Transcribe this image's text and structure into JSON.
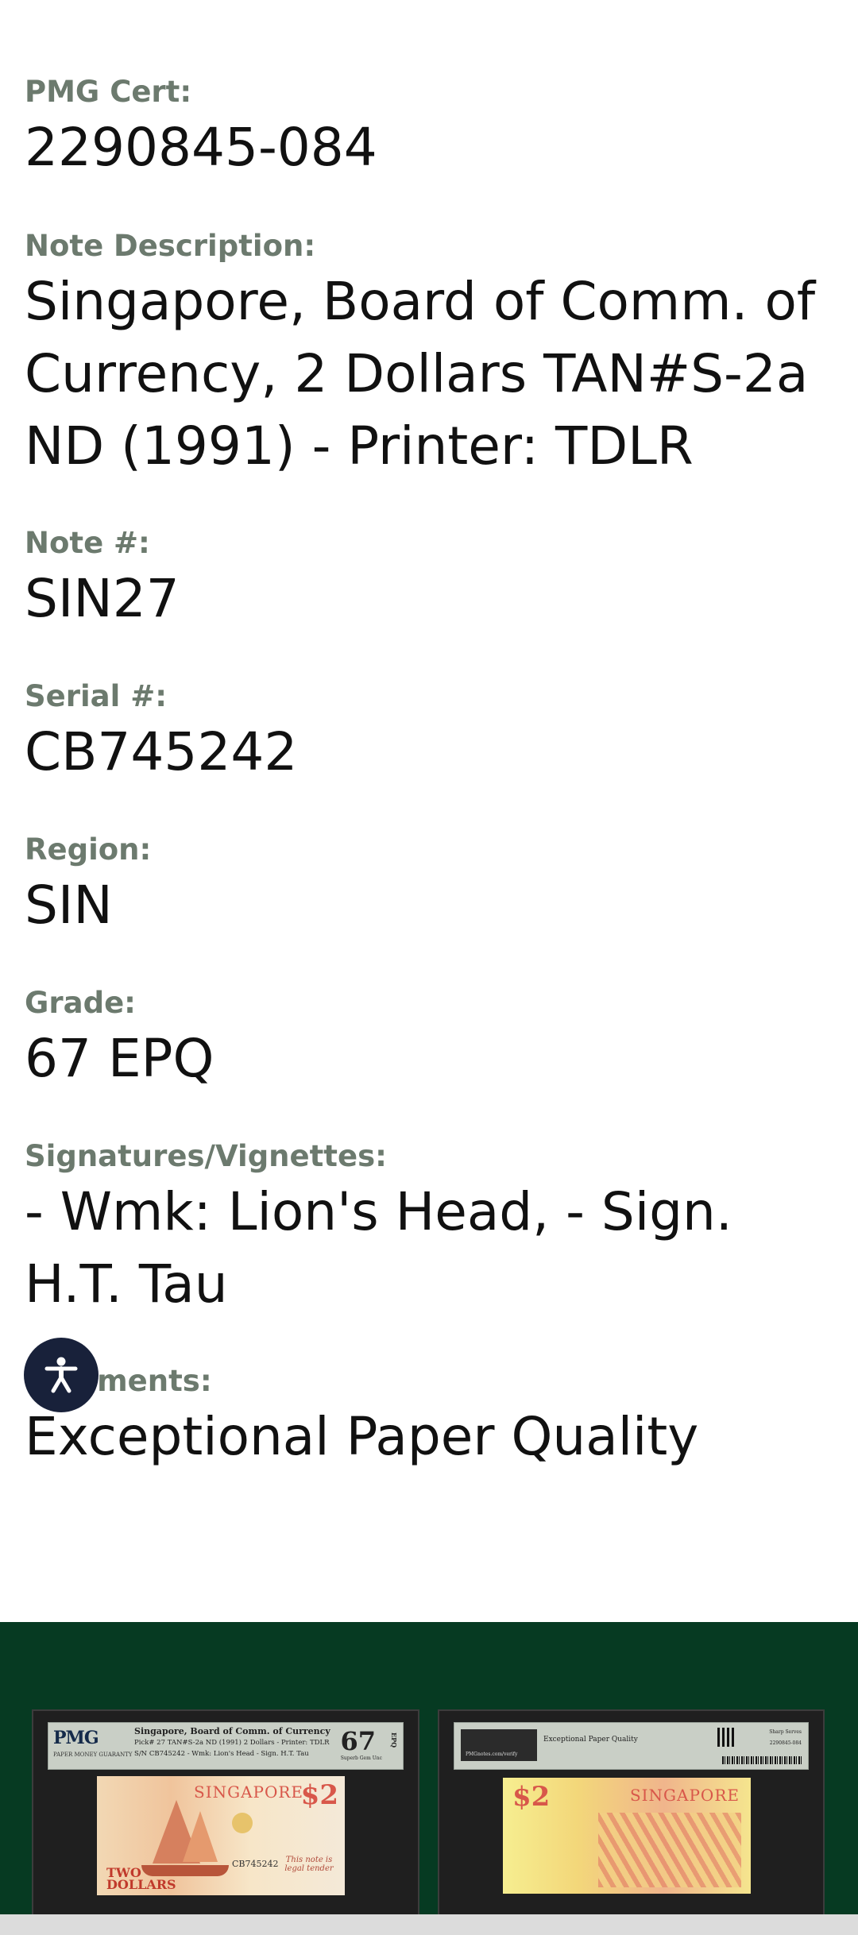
{
  "details": [
    {
      "key": "cert",
      "label": "PMG Cert:",
      "value": "2290845-084"
    },
    {
      "key": "description",
      "label": "Note Description:",
      "value": "Singapore, Board of Comm. of Currency, 2 Dollars TAN#S-2a ND (1991) - Printer: TDLR"
    },
    {
      "key": "note",
      "label": "Note #:",
      "value": "SIN27"
    },
    {
      "key": "serial",
      "label": "Serial #:",
      "value": "CB745242"
    },
    {
      "key": "region",
      "label": "Region:",
      "value": "SIN"
    },
    {
      "key": "grade",
      "label": "Grade:",
      "value": "67 EPQ"
    },
    {
      "key": "signatures",
      "label": "Signatures/Vignettes:",
      "value": "- Wmk: Lion's Head, - Sign. H.T. Tau"
    },
    {
      "key": "comments",
      "label": "Comments:",
      "value": "Exceptional Paper Quality"
    }
  ],
  "accessibility_button": {
    "icon": "accessibility-icon"
  },
  "colors": {
    "label": "#6c7a6e",
    "value": "#111111",
    "band": "#063a22",
    "a11y": "#18213a"
  },
  "images": {
    "front": {
      "pmg_logo": "PMG",
      "pmg_tagline": "PAPER MONEY GUARANTY",
      "line1": "Singapore, Board of Comm. of Currency",
      "line2": "Pick# 27  TAN#S-2a   ND (1991)  2 Dollars - Printer: TDLR",
      "line3": "S/N CB745242 - Wmk: Lion's Head - Sign. H.T. Tau",
      "grade": "67",
      "grade_text": "Superb Gem Unc",
      "epq": "EPQ",
      "note_title": "SINGAPORE",
      "note_denom": "$2",
      "note_two": "TWO DOLLARS",
      "note_serial": "CB745242",
      "note_legal": "This note is legal tender"
    },
    "back": {
      "logo_text": "PMGnotes.com/verify",
      "comment": "Exceptional Paper Quality",
      "small1": "Sharp Serves",
      "small2": "2290845-084",
      "note_title": "SINGAPORE",
      "note_denom": "$2"
    }
  }
}
